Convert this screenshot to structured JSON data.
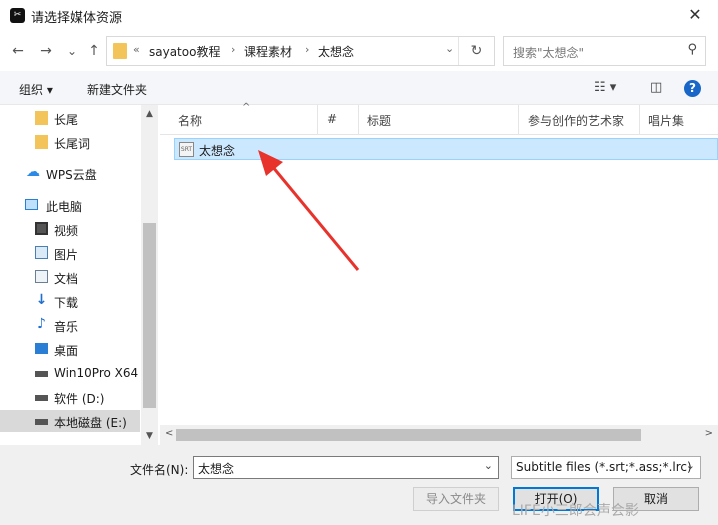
{
  "window": {
    "title": "请选择媒体资源",
    "app_icon": "capcut-logo",
    "close_label": "✕"
  },
  "nav": {
    "back_icon": "←",
    "forward_icon": "→",
    "recent_icon": "⌄",
    "up_icon": "↑",
    "overflow": "«",
    "breadcrumbs": [
      "sayatoo教程",
      "课程素材",
      "太想念"
    ],
    "refresh_icon": "↻",
    "search_placeholder": "搜索\"太想念\"",
    "search_icon": "⚲"
  },
  "toolbar": {
    "organize": "组织 ▾",
    "new_folder": "新建文件夹",
    "help": "?"
  },
  "sidebar": {
    "scroll_up": "▲",
    "scroll_down": "▼",
    "items": [
      {
        "label": "长尾",
        "icon": "folder-icon"
      },
      {
        "label": "长尾词",
        "icon": "folder-icon"
      },
      {
        "label": "WPS云盘",
        "icon": "cloud-icon"
      },
      {
        "label": "此电脑",
        "icon": "computer-icon"
      },
      {
        "label": "视频",
        "icon": "video-icon"
      },
      {
        "label": "图片",
        "icon": "picture-icon"
      },
      {
        "label": "文档",
        "icon": "document-icon"
      },
      {
        "label": "下载",
        "icon": "download-icon"
      },
      {
        "label": "音乐",
        "icon": "music-icon"
      },
      {
        "label": "桌面",
        "icon": "desktop-icon"
      },
      {
        "label": "Win10Pro X64",
        "icon": "drive-icon"
      },
      {
        "label": "软件 (D:)",
        "icon": "drive-icon"
      },
      {
        "label": "本地磁盘 (E:)",
        "icon": "drive-icon"
      }
    ]
  },
  "columns": [
    "名称",
    "#",
    "标题",
    "参与创作的艺术家",
    "唱片集"
  ],
  "sort_indicator": "^",
  "files": [
    {
      "name": "太想念",
      "icon_text": "SRT"
    }
  ],
  "hscroll": {
    "left": "<",
    "right": ">"
  },
  "bottom": {
    "filename_label": "文件名(N):",
    "filename_value": "太想念",
    "dropdown_icon": "⌄",
    "filter": "Subtitle files (*.srt;*.ass;*.lrc)",
    "import_folder": "导入文件夹",
    "open": "打开(O)",
    "cancel": "取消"
  },
  "watermark": "LIFE小三郎会声会影",
  "colors": {
    "selection": "#cce8ff",
    "accent": "#0078d7",
    "arrow": "#e8322c",
    "folder": "#f3c45a"
  }
}
